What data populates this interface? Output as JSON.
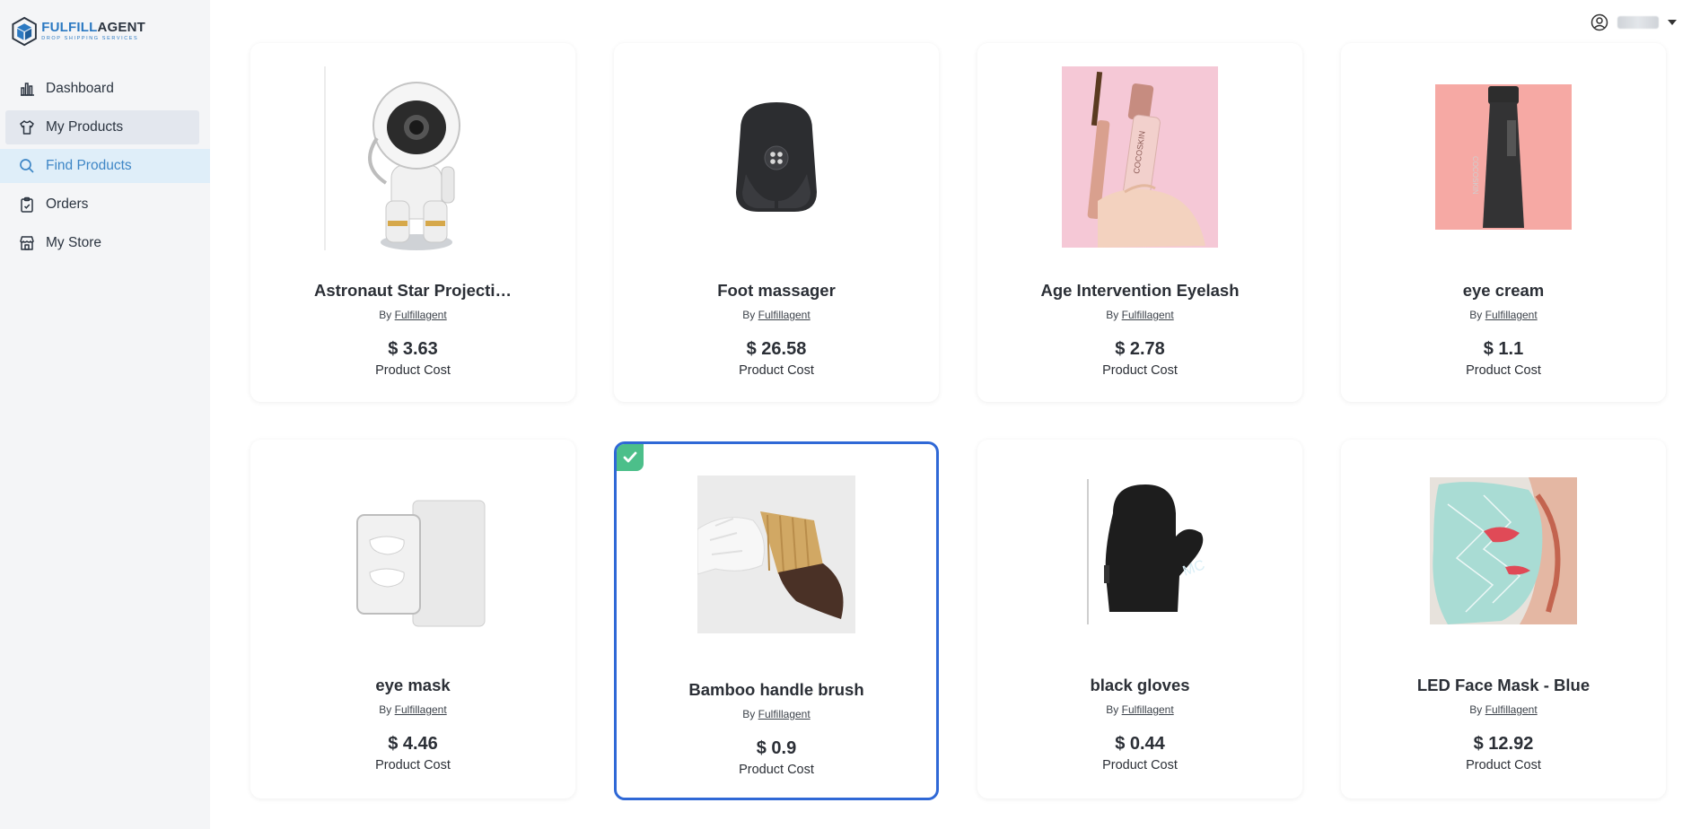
{
  "brand": {
    "title_part1": "FULFILL",
    "title_part2": "AGENT",
    "subtitle": "DROP SHIPPING SERVICES"
  },
  "nav": [
    {
      "label": "Dashboard",
      "icon": "bar-chart-icon"
    },
    {
      "label": "My Products",
      "icon": "shirt-icon"
    },
    {
      "label": "Find Products",
      "icon": "search-icon"
    },
    {
      "label": "Orders",
      "icon": "clipboard-icon"
    },
    {
      "label": "My Store",
      "icon": "store-icon"
    }
  ],
  "header": {
    "user_icon": "user-circle-icon"
  },
  "products": [
    {
      "title": "Astronaut Star Projecti…",
      "by_prefix": "By",
      "vendor": "Fulfillagent",
      "price": "$ 3.63",
      "cost_label": "Product Cost",
      "image": "astronaut-projector"
    },
    {
      "title": "Foot massager",
      "by_prefix": "By",
      "vendor": "Fulfillagent",
      "price": "$ 26.58",
      "cost_label": "Product Cost",
      "image": "foot-massager"
    },
    {
      "title": "Age Intervention Eyelash",
      "by_prefix": "By",
      "vendor": "Fulfillagent",
      "price": "$ 2.78",
      "cost_label": "Product Cost",
      "image": "eyelash-serum"
    },
    {
      "title": "eye cream",
      "by_prefix": "By",
      "vendor": "Fulfillagent",
      "price": "$ 1.1",
      "cost_label": "Product Cost",
      "image": "eye-cream-tube"
    },
    {
      "title": "eye mask",
      "by_prefix": "By",
      "vendor": "Fulfillagent",
      "price": "$ 4.46",
      "cost_label": "Product Cost",
      "image": "eye-mask-pack"
    },
    {
      "title": "Bamboo handle brush",
      "by_prefix": "By",
      "vendor": "Fulfillagent",
      "price": "$ 0.9",
      "cost_label": "Product Cost",
      "image": "bamboo-brush",
      "selected": true
    },
    {
      "title": "black gloves",
      "by_prefix": "By",
      "vendor": "Fulfillagent",
      "price": "$ 0.44",
      "cost_label": "Product Cost",
      "image": "black-mitt"
    },
    {
      "title": "LED Face Mask - Blue",
      "by_prefix": "By",
      "vendor": "Fulfillagent",
      "price": "$ 12.92",
      "cost_label": "Product Cost",
      "image": "led-face-mask"
    }
  ],
  "colors": {
    "accent": "#3e86c6",
    "selected_border": "#2f68d6",
    "check_badge": "#4cbf8a"
  }
}
